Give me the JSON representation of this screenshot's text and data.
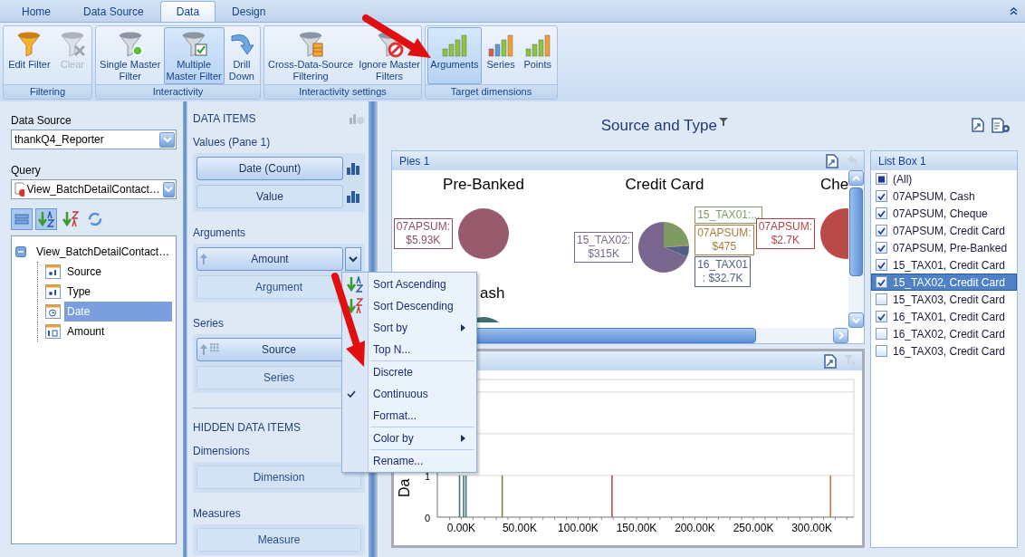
{
  "tabs": [
    {
      "label": "Home",
      "selected": false
    },
    {
      "label": "Data Source",
      "selected": false
    },
    {
      "label": "Data",
      "selected": true
    },
    {
      "label": "Design",
      "selected": false
    }
  ],
  "ribbon_groups": [
    {
      "label": "Filtering",
      "buttons": [
        {
          "kind": "edit-filter",
          "lines": [
            "Edit Filter"
          ],
          "selected": false,
          "disabled": false
        },
        {
          "kind": "clear",
          "lines": [
            "Clear"
          ],
          "selected": false,
          "disabled": true
        }
      ]
    },
    {
      "label": "Interactivity",
      "buttons": [
        {
          "kind": "single",
          "lines": [
            "Single Master",
            "Filter"
          ],
          "selected": false,
          "disabled": false
        },
        {
          "kind": "multiple",
          "lines": [
            "Multiple",
            "Master Filter"
          ],
          "selected": true,
          "disabled": false
        },
        {
          "kind": "drill",
          "lines": [
            "Drill",
            "Down"
          ],
          "selected": false,
          "disabled": false
        }
      ]
    },
    {
      "label": "Interactivity settings",
      "buttons": [
        {
          "kind": "cross",
          "lines": [
            "Cross-Data-Source",
            "Filtering"
          ],
          "selected": false,
          "disabled": false
        },
        {
          "kind": "ignore",
          "lines": [
            "Ignore Master",
            "Filters"
          ],
          "selected": false,
          "disabled": false
        }
      ]
    },
    {
      "label": "Target dimensions",
      "buttons": [
        {
          "kind": "arguments",
          "lines": [
            "Arguments"
          ],
          "selected": true,
          "disabled": false
        },
        {
          "kind": "series",
          "lines": [
            "Series"
          ],
          "selected": false,
          "disabled": false
        },
        {
          "kind": "points",
          "lines": [
            "Points"
          ],
          "selected": false,
          "disabled": false
        }
      ]
    }
  ],
  "data_source": {
    "label": "Data Source",
    "value": "thankQ4_Reporter"
  },
  "query": {
    "label": "Query",
    "value": "View_BatchDetailContact…"
  },
  "field_toolbar": [
    {
      "kind": "group",
      "selected": true
    },
    {
      "kind": "sort-az",
      "selected": true
    },
    {
      "kind": "sort-za",
      "selected": false
    },
    {
      "kind": "refresh",
      "selected": false
    }
  ],
  "field_tree": [
    {
      "label": "View_BatchDetailContact…",
      "expanded": true,
      "selected": false,
      "children": [
        {
          "label": "Source",
          "kind": "text",
          "selected": false
        },
        {
          "label": "Type",
          "kind": "text",
          "selected": false
        },
        {
          "label": "Date",
          "kind": "date",
          "selected": true
        },
        {
          "label": "Amount",
          "kind": "number",
          "selected": false
        }
      ]
    }
  ],
  "data_items": {
    "title": "DATA ITEMS",
    "sections": [
      {
        "label": "Values (Pane 1)",
        "items": [
          {
            "label": "Date (Count)",
            "kind": "measure",
            "filled": true,
            "dropdown": false
          },
          {
            "label": "Value",
            "kind": "measure",
            "filled": false,
            "dropdown": false
          }
        ]
      },
      {
        "label": "Arguments",
        "items": [
          {
            "label": "Amount",
            "kind": "dimension",
            "filled": true,
            "dropdown": true
          },
          {
            "label": "Argument",
            "kind": "empty",
            "filled": false,
            "dropdown": false
          }
        ]
      },
      {
        "label": "Series",
        "items": [
          {
            "label": "Source",
            "kind": "grid-dimension",
            "filled": true,
            "dropdown": false
          },
          {
            "label": "Series",
            "kind": "empty",
            "filled": false,
            "dropdown": false
          }
        ]
      }
    ],
    "hidden_title": "HIDDEN DATA ITEMS",
    "hidden_sections": [
      {
        "label": "Dimensions",
        "items": [
          {
            "label": "Dimension",
            "kind": "empty",
            "filled": false,
            "dropdown": false
          }
        ]
      },
      {
        "label": "Measures",
        "items": [
          {
            "label": "Measure",
            "kind": "empty",
            "filled": false,
            "dropdown": false
          }
        ]
      }
    ]
  },
  "dashboard_title": "Source and Type",
  "pies": {
    "title": "Pies 1",
    "items": [
      {
        "title": "Pre-Banked",
        "kind": "full",
        "color": "#975b6d",
        "labels": [
          {
            "lines": [
              "07APSUM:",
              "$5.93K"
            ],
            "color": "#8e4d60"
          }
        ]
      },
      {
        "title": "Credit Card",
        "kind": "split",
        "labels": [
          {
            "lines": [
              "15_TAX02:",
              "$315K"
            ],
            "color": "#7a6790"
          },
          {
            "lines": [
              "15_TAX01:..."
            ],
            "color": "#7f9a63"
          },
          {
            "lines": [
              "07APSUM:",
              "$475"
            ],
            "color": "#a87b3c"
          },
          {
            "lines": [
              "16_TAX01",
              ": $32.7K"
            ],
            "color": "#4f5f86"
          }
        ]
      },
      {
        "title": "Che",
        "kind": "edge",
        "color": "#b94a48",
        "labels": [
          {
            "lines": [
              "07APSUM:",
              "$2.7K"
            ],
            "color": "#b04444"
          }
        ]
      },
      {
        "title": "ash",
        "kind": "covered",
        "color": "#3e6e70"
      }
    ]
  },
  "chart": {
    "chart_data": {
      "type": "bar",
      "ylabel": "Da",
      "x": [
        -1.5,
        2,
        4,
        35,
        129,
        316
      ],
      "series": [
        {
          "color": "#3e6e70",
          "values": [
            1,
            1,
            1,
            null,
            null,
            null
          ]
        },
        {
          "color": "#7b7d45",
          "values": [
            null,
            null,
            null,
            1,
            null,
            null
          ]
        },
        {
          "color": "#b2444a",
          "values": [
            null,
            null,
            null,
            null,
            1,
            null
          ]
        },
        {
          "color": "#b07d3a",
          "values": [
            null,
            null,
            null,
            null,
            null,
            1
          ]
        }
      ],
      "xlim": [
        -20.5,
        336
      ],
      "ylim": [
        0,
        3.3
      ],
      "xticks": [
        {
          "value": 0,
          "label": "0.00K"
        },
        {
          "value": 50,
          "label": "50.00K"
        },
        {
          "value": 100,
          "label": "100.00K"
        },
        {
          "value": 150,
          "label": "150.00K"
        },
        {
          "value": 200,
          "label": "200.00K"
        },
        {
          "value": 250,
          "label": "250.00K"
        },
        {
          "value": 300,
          "label": "300.00K"
        }
      ],
      "yticks": [
        0,
        1
      ]
    }
  },
  "list_box": {
    "title": "List Box 1",
    "items": [
      {
        "label": "(All)",
        "checked": false,
        "indeterminate": true,
        "selected": false
      },
      {
        "label": "07APSUM, Cash",
        "checked": true,
        "indeterminate": false,
        "selected": false
      },
      {
        "label": "07APSUM, Cheque",
        "checked": true,
        "indeterminate": false,
        "selected": false
      },
      {
        "label": "07APSUM, Credit Card",
        "checked": true,
        "indeterminate": false,
        "selected": false
      },
      {
        "label": "07APSUM, Pre-Banked",
        "checked": true,
        "indeterminate": false,
        "selected": false
      },
      {
        "label": "15_TAX01, Credit Card",
        "checked": true,
        "indeterminate": false,
        "selected": false
      },
      {
        "label": "15_TAX02, Credit Card",
        "checked": true,
        "indeterminate": false,
        "selected": true
      },
      {
        "label": "15_TAX03, Credit Card",
        "checked": false,
        "indeterminate": false,
        "selected": false
      },
      {
        "label": "16_TAX01, Credit Card",
        "checked": true,
        "indeterminate": false,
        "selected": false
      },
      {
        "label": "16_TAX02, Credit Card",
        "checked": false,
        "indeterminate": false,
        "selected": false
      },
      {
        "label": "16_TAX03, Credit Card",
        "checked": false,
        "indeterminate": false,
        "selected": false
      }
    ]
  },
  "context_menu": [
    {
      "kind": "sort-asc",
      "label": "Sort Ascending",
      "checked": false
    },
    {
      "kind": "sort-desc",
      "label": "Sort Descending",
      "checked": false
    },
    {
      "kind": "submenu",
      "label": "Sort by",
      "checked": false
    },
    {
      "kind": "item",
      "label": "Top N...",
      "checked": false
    },
    {
      "kind": "separator"
    },
    {
      "kind": "item",
      "label": "Discrete",
      "checked": false
    },
    {
      "kind": "item",
      "label": "Continuous",
      "checked": true
    },
    {
      "kind": "item",
      "label": "Format...",
      "checked": false
    },
    {
      "kind": "separator"
    },
    {
      "kind": "submenu",
      "label": "Color by",
      "checked": false
    },
    {
      "kind": "separator"
    },
    {
      "kind": "item",
      "label": "Rename...",
      "checked": false
    }
  ]
}
